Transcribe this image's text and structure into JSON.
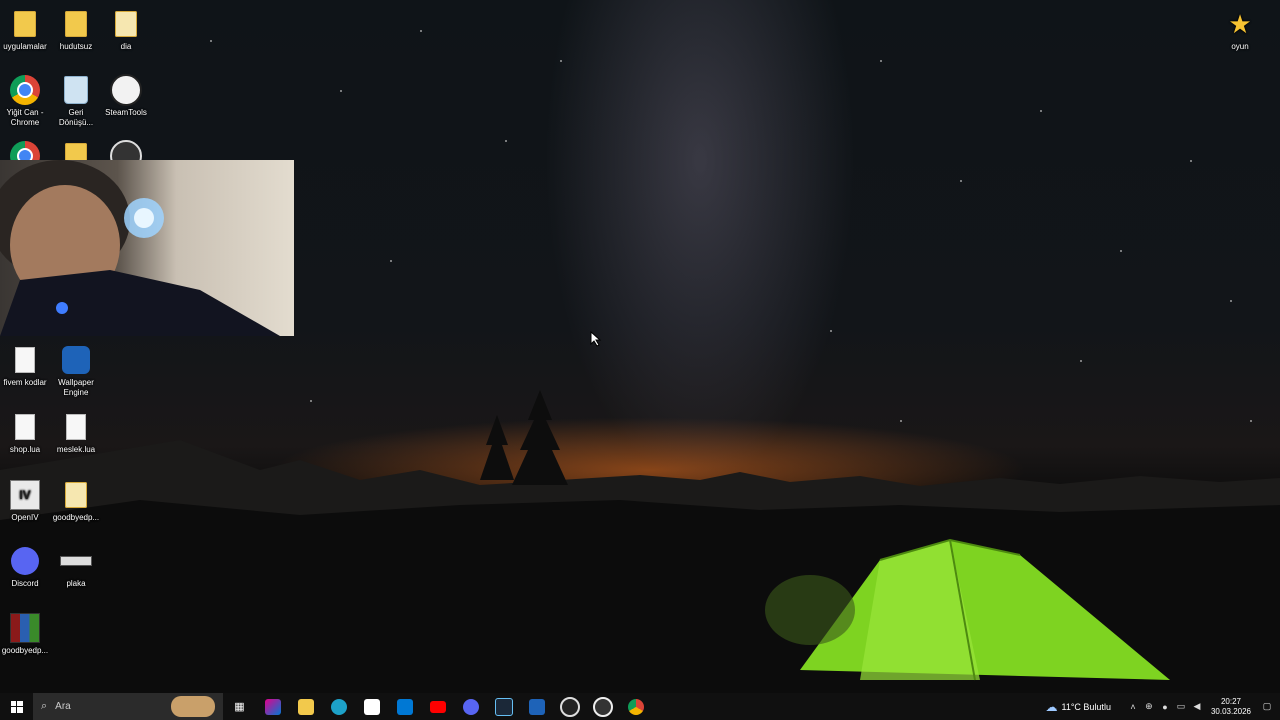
{
  "desktop_icons": {
    "uygulamalar": "uygulamalar",
    "hudutsuz": "hudutsuz",
    "dia": "dia",
    "oyun": "oyun",
    "chrome_line1": "Yiğit Can -",
    "chrome_line2": "Chrome",
    "recycle_line1": "Geri",
    "recycle_line2": "Dönüşü...",
    "steamtools": "SteamTools",
    "fivem": "fivem kodlar",
    "wallpaper_line1": "Wallpaper",
    "wallpaper_line2": "Engine",
    "shop": "shop.lua",
    "meslek": "meslek.lua",
    "openiv": "OpenIV",
    "goodbye1": "goodbyedp...",
    "discord": "Discord",
    "plaka": "plaka",
    "goodbye2": "goodbyedp..."
  },
  "taskbar": {
    "search_placeholder": "Ara",
    "weather": "11°C  Bulutlu",
    "time": "20:27",
    "date": "30.03.2026"
  },
  "colors": {
    "taskbar_bg": "#101010",
    "tent_green": "#7ed321"
  }
}
